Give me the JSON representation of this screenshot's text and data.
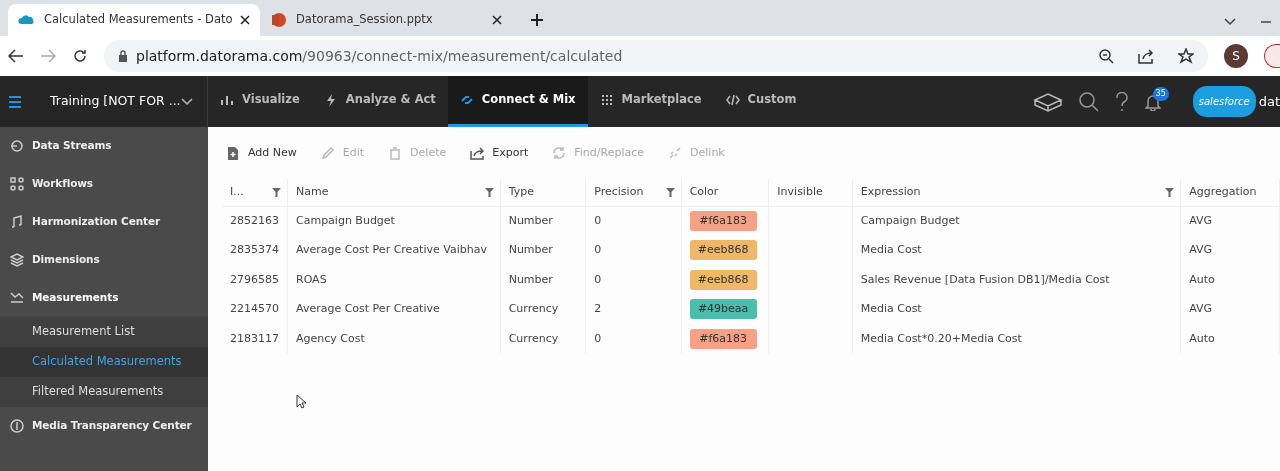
{
  "browser": {
    "tabs": [
      {
        "title": "Calculated Measurements - Dato",
        "kind": "cloud",
        "selected": true
      },
      {
        "title": "Datorama_Session.pptx",
        "kind": "slides",
        "selected": false
      }
    ],
    "url_host": "platform.datorama.com",
    "url_path": "/90963/connect-mix/measurement/calculated",
    "profile": "S"
  },
  "app_nav": {
    "workspace": "Training [NOT FOR ...",
    "items": [
      {
        "label": "Visualize",
        "kind": "bars",
        "selected": false
      },
      {
        "label": "Analyze & Act",
        "kind": "bolt",
        "selected": false
      },
      {
        "label": "Connect & Mix",
        "kind": "link",
        "selected": true
      },
      {
        "label": "Marketplace",
        "kind": "grid",
        "selected": false
      },
      {
        "label": "Custom",
        "kind": "code",
        "selected": false
      }
    ],
    "notifications": "35",
    "brand": "salesforce",
    "product": "dat"
  },
  "sidebar": {
    "items": [
      {
        "label": "Data Streams",
        "kind": "stream",
        "expanded": false
      },
      {
        "label": "Workflows",
        "kind": "flow",
        "expanded": false
      },
      {
        "label": "Harmonization Center",
        "kind": "harmony",
        "expanded": false
      },
      {
        "label": "Dimensions",
        "kind": "layers",
        "expanded": false
      },
      {
        "label": "Measurements",
        "kind": "measure",
        "expanded": true,
        "children": [
          {
            "label": "Measurement List",
            "selected": false
          },
          {
            "label": "Calculated Measurements",
            "selected": true
          },
          {
            "label": "Filtered Measurements",
            "selected": false
          }
        ]
      },
      {
        "label": "Media Transparency Center",
        "kind": "coin",
        "expanded": false
      }
    ]
  },
  "toolbar": [
    {
      "label": "Add New",
      "kind": "add",
      "disabled": false
    },
    {
      "label": "Edit",
      "kind": "edit",
      "disabled": true
    },
    {
      "label": "Delete",
      "kind": "delete",
      "disabled": true
    },
    {
      "label": "Export",
      "kind": "export",
      "disabled": false
    },
    {
      "label": "Find/Replace",
      "kind": "replace",
      "disabled": true
    },
    {
      "label": "Delink",
      "kind": "delink",
      "disabled": true
    }
  ],
  "table": {
    "columns": [
      {
        "label": "I...",
        "filter": true
      },
      {
        "label": "Name",
        "filter": true
      },
      {
        "label": "Type",
        "filter": false
      },
      {
        "label": "Precision",
        "filter": true
      },
      {
        "label": "Color",
        "filter": false
      },
      {
        "label": "Invisible",
        "filter": false
      },
      {
        "label": "Expression",
        "filter": true
      },
      {
        "label": "Aggregation",
        "filter": false
      }
    ],
    "rows": [
      {
        "id": "2852163",
        "name": "Campaign Budget",
        "type": "Number",
        "precision": "0",
        "color": "#f6a183",
        "expression": "Campaign Budget",
        "aggregation": "AVG"
      },
      {
        "id": "2835374",
        "name": "Average Cost Per Creative Vaibhav",
        "type": "Number",
        "precision": "0",
        "color": "#eeb868",
        "expression": "Media Cost",
        "aggregation": "AVG"
      },
      {
        "id": "2796585",
        "name": "ROAS",
        "type": "Number",
        "precision": "0",
        "color": "#eeb868",
        "expression": "Sales Revenue [Data Fusion DB1]/Media Cost",
        "aggregation": "Auto"
      },
      {
        "id": "2214570",
        "name": "Average Cost Per Creative",
        "type": "Currency",
        "precision": "2",
        "color": "#49beaa",
        "expression": "Media Cost",
        "aggregation": "AVG"
      },
      {
        "id": "2183117",
        "name": "Agency Cost",
        "type": "Currency",
        "precision": "0",
        "color": "#f6a183",
        "expression": "Media Cost*0.20+Media Cost",
        "aggregation": "Auto"
      }
    ]
  }
}
